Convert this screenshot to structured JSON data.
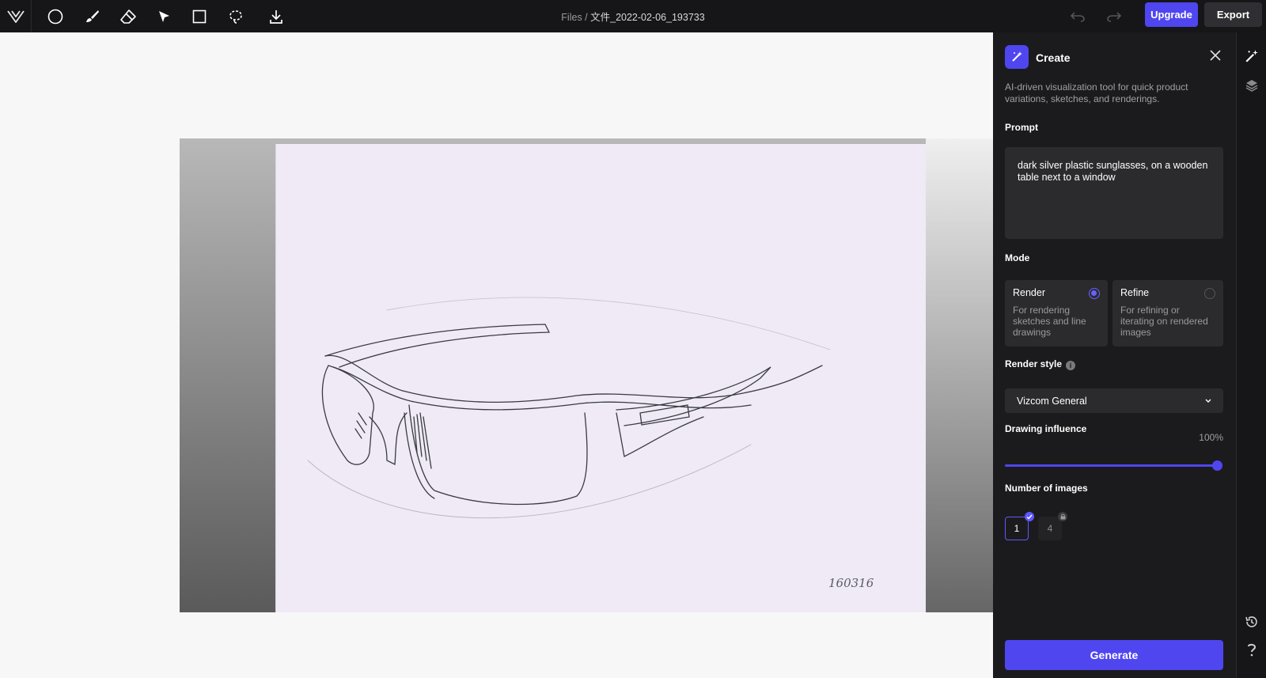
{
  "toolbar": {
    "tools": [
      "logo-icon",
      "circle-icon",
      "brush-icon",
      "eraser-icon",
      "pointer-icon",
      "rectangle-icon",
      "lasso-icon",
      "download-icon"
    ],
    "breadcrumb_root": "Files",
    "breadcrumb_sep": " / ",
    "file_name": "文件_2022-02-06_193733",
    "upgrade_label": "Upgrade",
    "export_label": "Export"
  },
  "canvas": {
    "sketch_annotation": "160316"
  },
  "panel": {
    "title": "Create",
    "description": "AI-driven visualization tool for quick product variations, sketches, and renderings.",
    "prompt_label": "Prompt",
    "prompt_value": "dark silver plastic sunglasses, on a wooden table next to a window",
    "mode_label": "Mode",
    "modes": [
      {
        "title": "Render",
        "desc": "For rendering sketches and line drawings",
        "selected": true
      },
      {
        "title": "Refine",
        "desc": "For refining or iterating on rendered images",
        "selected": false
      }
    ],
    "render_style_label": "Render style",
    "render_style_value": "Vizcom General",
    "influence_label": "Drawing influence",
    "influence_value": "100%",
    "influence_level": 1.0,
    "num_images_label": "Number of images",
    "num_options": [
      "1",
      "4"
    ],
    "generate_label": "Generate"
  },
  "rail": {
    "icons": [
      "magic-wand-icon",
      "layers-icon",
      "history-icon",
      "help-icon"
    ]
  },
  "colors": {
    "accent": "#4f46f0",
    "panel_bg": "#1b1b1d",
    "toolbar_bg": "#161618"
  }
}
